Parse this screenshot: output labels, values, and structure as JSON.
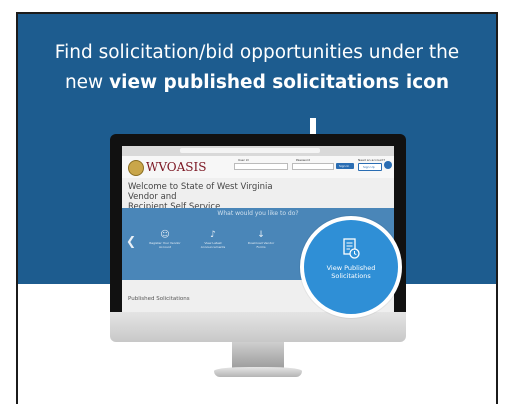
{
  "headline": {
    "line1": "Find solicitation/bid opportunities under the",
    "line2_prefix": "new ",
    "line2_bold": "view published solicitations icon"
  },
  "screen": {
    "logo": "WVOASIS",
    "user_id_label": "User Id",
    "password_label": "Password",
    "need_account_label": "Need an account?",
    "sign_in_label": "Sign In",
    "sign_up_label": "Sign Up",
    "welcome_line1": "Welcome to State of West Virginia Vendor and",
    "welcome_line2": "Recipient Self Service",
    "band_title": "What would you like to do?",
    "items": [
      {
        "label": "Register Your Vendor Account",
        "icon": "user-icon"
      },
      {
        "label": "View Latest Announcements",
        "icon": "megaphone-icon"
      },
      {
        "label": "Download Vendor Forms",
        "icon": "download-icon"
      }
    ],
    "published_label": "Published Solicitations"
  },
  "highlight": {
    "label_line1": "View Published",
    "label_line2": "Solicitations",
    "icon": "document-clock-icon"
  },
  "colors": {
    "hero_blue": "#1d5c8f",
    "circle_blue": "#2f8fd6",
    "band_blue": "#4a86b8",
    "logo_red": "#7a1420"
  }
}
